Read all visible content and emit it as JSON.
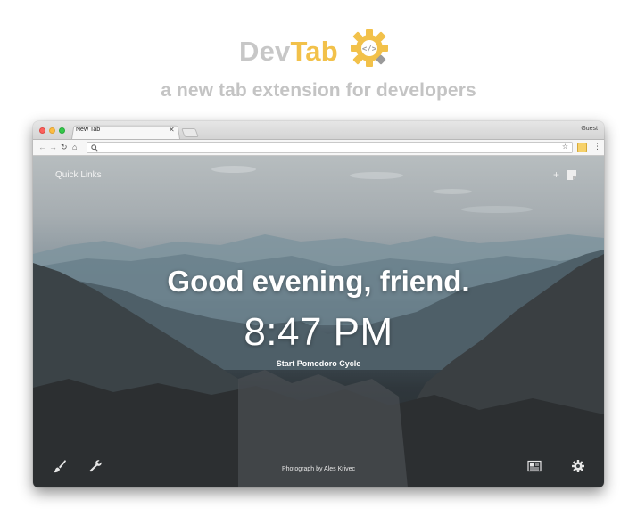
{
  "brand": {
    "title_part1": "Dev",
    "title_part2": "Tab",
    "tagline": "a new tab extension for developers",
    "accent_color": "#f2c14a",
    "muted_color": "#c7c7c7",
    "logo_icon": "gear-code-icon"
  },
  "browser": {
    "tab_title": "New Tab",
    "profile_label": "Guest",
    "omnibox_value": ""
  },
  "page": {
    "quick_links_label": "Quick Links",
    "greeting": "Good evening, friend.",
    "time": "8:47 PM",
    "pomodoro_label": "Start Pomodoro Cycle",
    "photo_credit": "Photograph by Ales Krivec",
    "icons": {
      "top_right": [
        "plus-icon",
        "note-icon"
      ],
      "bottom_left": [
        "brush-icon",
        "wrench-icon"
      ],
      "bottom_right": [
        "news-icon",
        "gear-icon"
      ]
    }
  }
}
